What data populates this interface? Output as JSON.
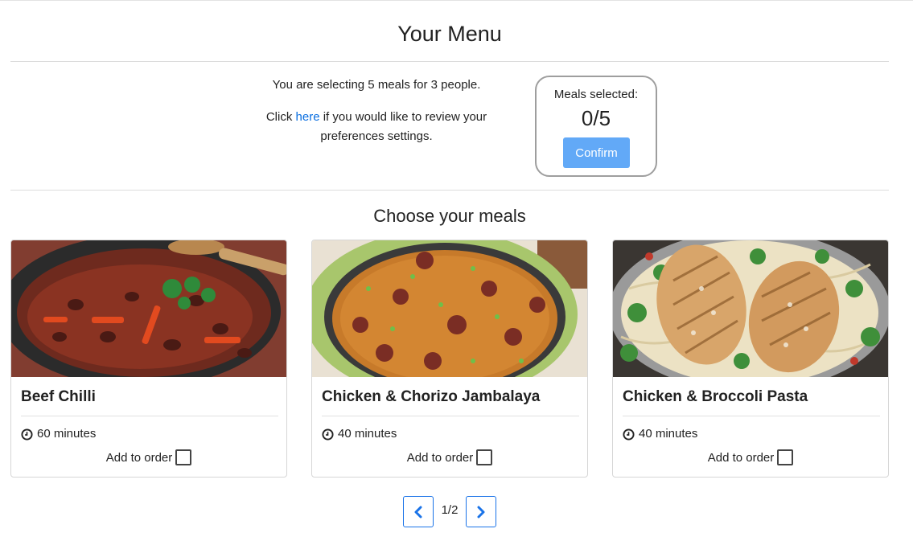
{
  "header": {
    "title": "Your Menu"
  },
  "intro": {
    "line1": "You are selecting 5 meals for 3 people.",
    "line2_prefix": "Click ",
    "line2_link": "here",
    "line2_suffix": " if you would like to review your preferences settings."
  },
  "counter": {
    "label": "Meals selected:",
    "value": "0/5",
    "confirm_label": "Confirm"
  },
  "section": {
    "title": "Choose your meals"
  },
  "meals": [
    {
      "name": "Beef Chilli",
      "time": "60 minutes",
      "add_label": "Add to order",
      "checked": false,
      "image_icon": "beef-chilli-photo"
    },
    {
      "name": "Chicken & Chorizo Jambalaya",
      "time": "40 minutes",
      "add_label": "Add to order",
      "checked": false,
      "image_icon": "jambalaya-photo"
    },
    {
      "name": "Chicken & Broccoli Pasta",
      "time": "40 minutes",
      "add_label": "Add to order",
      "checked": false,
      "image_icon": "chicken-pasta-photo"
    }
  ],
  "pagination": {
    "label": "1/2",
    "prev_icon": "chevron-left-icon",
    "next_icon": "chevron-right-icon"
  },
  "colors": {
    "accent": "#0a6ee0",
    "confirm_bg": "#62a9f7",
    "pager_border": "#1a73e8"
  }
}
